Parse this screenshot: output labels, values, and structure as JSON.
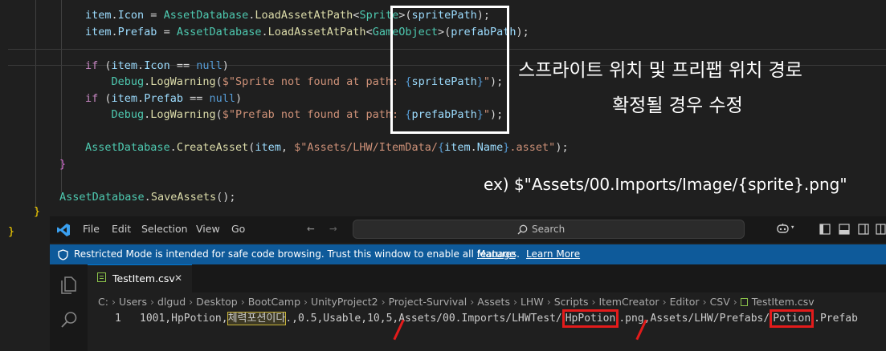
{
  "code": {
    "lines": [
      [
        [
          "item",
          "#9cdcfe"
        ],
        [
          ".",
          "#d4d4d4"
        ],
        [
          "Icon",
          "#9cdcfe"
        ],
        [
          " = ",
          "#d4d4d4"
        ],
        [
          "AssetDatabase",
          "#4ec9b0"
        ],
        [
          ".",
          "#d4d4d4"
        ],
        [
          "LoadAssetAtPath",
          "#dcdcaa"
        ],
        [
          "<",
          "#d4d4d4"
        ],
        [
          "Sprite",
          "#4ec9b0"
        ],
        [
          ">(",
          "#d4d4d4"
        ],
        [
          "spritePath",
          "#9cdcfe"
        ],
        [
          ");",
          "#d4d4d4"
        ]
      ],
      [
        [
          "item",
          "#9cdcfe"
        ],
        [
          ".",
          "#d4d4d4"
        ],
        [
          "Prefab",
          "#9cdcfe"
        ],
        [
          " = ",
          "#d4d4d4"
        ],
        [
          "AssetDatabase",
          "#4ec9b0"
        ],
        [
          ".",
          "#d4d4d4"
        ],
        [
          "LoadAssetAtPath",
          "#dcdcaa"
        ],
        [
          "<",
          "#d4d4d4"
        ],
        [
          "GameObject",
          "#4ec9b0"
        ],
        [
          ">(",
          "#d4d4d4"
        ],
        [
          "prefabPath",
          "#9cdcfe"
        ],
        [
          ");",
          "#d4d4d4"
        ]
      ],
      [],
      [
        [
          "if",
          "#c586c0"
        ],
        [
          " (",
          "#d4d4d4"
        ],
        [
          "item",
          "#9cdcfe"
        ],
        [
          ".",
          "#d4d4d4"
        ],
        [
          "Icon",
          "#9cdcfe"
        ],
        [
          " == ",
          "#d4d4d4"
        ],
        [
          "null",
          "#569cd6"
        ],
        [
          ")",
          "#d4d4d4"
        ]
      ],
      [
        [
          "    Debug",
          "#4ec9b0"
        ],
        [
          ".",
          "#d4d4d4"
        ],
        [
          "LogWarning",
          "#dcdcaa"
        ],
        [
          "(",
          "#d4d4d4"
        ],
        [
          "$\"Sprite not found at path: ",
          "#ce9178"
        ],
        [
          "{",
          "#569cd6"
        ],
        [
          "spritePath",
          "#9cdcfe"
        ],
        [
          "}",
          "#569cd6"
        ],
        [
          "\"",
          "#ce9178"
        ],
        [
          ");",
          "#d4d4d4"
        ]
      ],
      [
        [
          "if",
          "#c586c0"
        ],
        [
          " (",
          "#d4d4d4"
        ],
        [
          "item",
          "#9cdcfe"
        ],
        [
          ".",
          "#d4d4d4"
        ],
        [
          "Prefab",
          "#9cdcfe"
        ],
        [
          " == ",
          "#d4d4d4"
        ],
        [
          "null",
          "#569cd6"
        ],
        [
          ")",
          "#d4d4d4"
        ]
      ],
      [
        [
          "    Debug",
          "#4ec9b0"
        ],
        [
          ".",
          "#d4d4d4"
        ],
        [
          "LogWarning",
          "#dcdcaa"
        ],
        [
          "(",
          "#d4d4d4"
        ],
        [
          "$\"Prefab not found at path: ",
          "#ce9178"
        ],
        [
          "{",
          "#569cd6"
        ],
        [
          "prefabPath",
          "#9cdcfe"
        ],
        [
          "}",
          "#569cd6"
        ],
        [
          "\"",
          "#ce9178"
        ],
        [
          ");",
          "#d4d4d4"
        ]
      ],
      [],
      [
        [
          "AssetDatabase",
          "#4ec9b0"
        ],
        [
          ".",
          "#d4d4d4"
        ],
        [
          "CreateAsset",
          "#dcdcaa"
        ],
        [
          "(",
          "#d4d4d4"
        ],
        [
          "item",
          "#9cdcfe"
        ],
        [
          ", ",
          "#d4d4d4"
        ],
        [
          "$\"Assets/LHW/ItemData/",
          "#ce9178"
        ],
        [
          "{",
          "#569cd6"
        ],
        [
          "item",
          "#9cdcfe"
        ],
        [
          ".",
          "#d4d4d4"
        ],
        [
          "Name",
          "#9cdcfe"
        ],
        [
          "}",
          "#569cd6"
        ],
        [
          ".asset\"",
          "#ce9178"
        ],
        [
          ");",
          "#d4d4d4"
        ]
      ],
      [
        [
          "}",
          "#da70d6"
        ]
      ],
      [],
      [
        [
          "AssetDatabase",
          "#4ec9b0"
        ],
        [
          ".",
          "#d4d4d4"
        ],
        [
          "SaveAssets",
          "#dcdcaa"
        ],
        [
          "();",
          "#d4d4d4"
        ]
      ],
      [
        [
          "}",
          "#ffd700"
        ]
      ],
      [
        [
          "}",
          "#ffd700"
        ]
      ]
    ]
  },
  "annotation": {
    "line1": "스프라이트 위치 및 프리팹 위치 경로",
    "line2": "확정될 경우 수정",
    "example": "ex) $\"Assets/00.Imports/Image/{sprite}.png\""
  },
  "titlebar": {
    "menus": [
      "File",
      "Edit",
      "Selection",
      "View",
      "Go"
    ],
    "search_label": "Search"
  },
  "banner": {
    "message": "Restricted Mode is intended for safe code browsing. Trust this window to enable all features.",
    "manage": "Manage",
    "learn_more": "Learn More"
  },
  "tab": {
    "filename": "TestItem.csv",
    "close": "✕"
  },
  "breadcrumbs": [
    "C:",
    "Users",
    "dlgud",
    "Desktop",
    "BootCamp",
    "UnityProject2",
    "Project-Survival",
    "Assets",
    "LHW",
    "Scripts",
    "ItemCreator",
    "Editor",
    "CSV"
  ],
  "breadcrumb_file": "TestItem.csv",
  "csv": {
    "line_number": "1",
    "segments": [
      {
        "text": "1001,HpPotion,",
        "style": "plain"
      },
      {
        "text": "체력포션이다",
        "style": "highlight"
      },
      {
        "text": ".,0.5,Usable,10,5,Assets/00.Imports/LHWTest/",
        "style": "plain"
      },
      {
        "text": "HpPotion",
        "style": "boxed"
      },
      {
        "text": ".png,Assets/LHW/Prefabs/",
        "style": "plain"
      },
      {
        "text": "Potion",
        "style": "boxed"
      },
      {
        "text": ".Prefab",
        "style": "plain"
      }
    ]
  },
  "colors": {
    "accent": "#0078d4",
    "banner": "#0e5a9a",
    "annotation_red": "#e31b1b"
  }
}
